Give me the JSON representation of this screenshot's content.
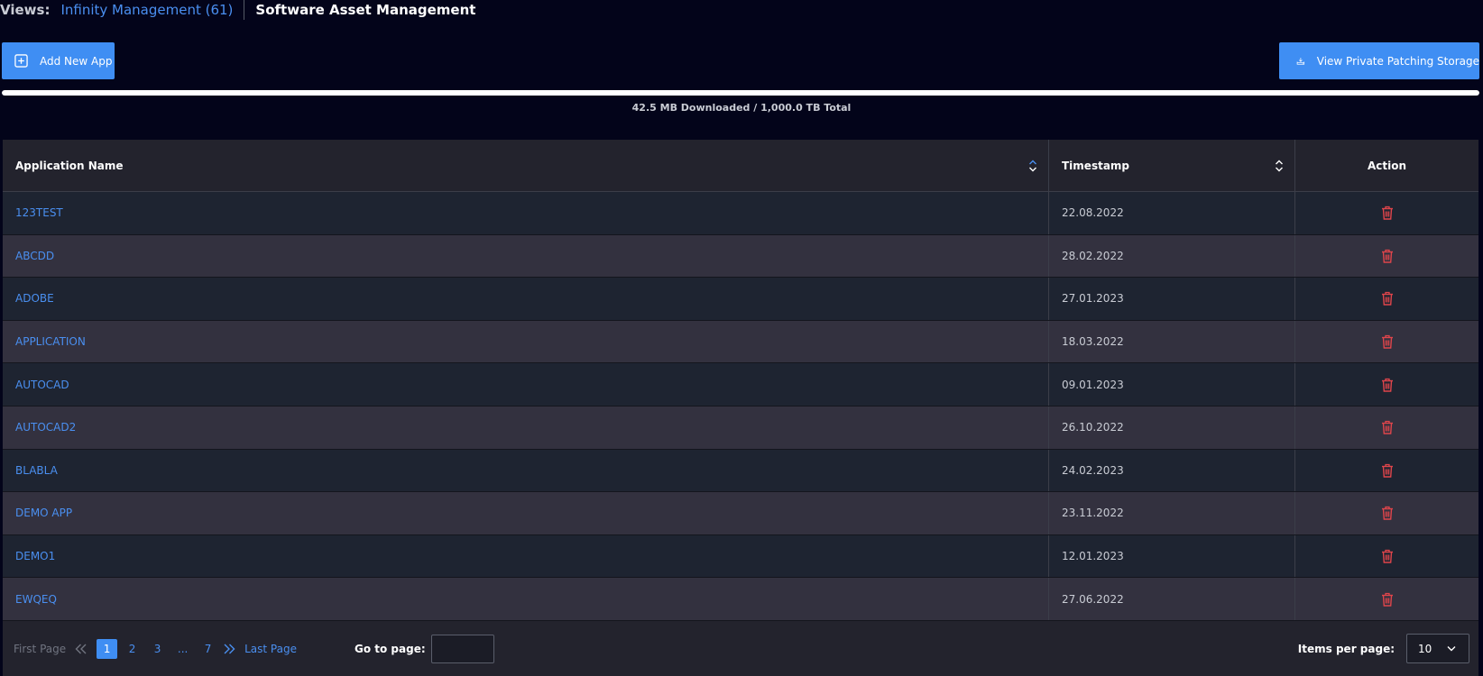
{
  "views": {
    "label": "Views:",
    "link": "Infinity Management (61)",
    "current": "Software Asset Management"
  },
  "toolbar": {
    "add_label": "Add New App",
    "storage_label": "View Private Patching Storage"
  },
  "storage": {
    "text": "42.5 MB Downloaded / 1,000.0 TB Total",
    "used_fraction": 1.0
  },
  "table": {
    "columns": [
      "Application Name",
      "Timestamp",
      "Action"
    ],
    "rows": [
      {
        "name": "123TEST",
        "timestamp": "22.08.2022"
      },
      {
        "name": "ABCDD",
        "timestamp": "28.02.2022"
      },
      {
        "name": "ADOBE",
        "timestamp": "27.01.2023"
      },
      {
        "name": "APPLICATION",
        "timestamp": "18.03.2022"
      },
      {
        "name": "AUTOCAD",
        "timestamp": "09.01.2023"
      },
      {
        "name": "AUTOCAD2",
        "timestamp": "26.10.2022"
      },
      {
        "name": "BLABLA",
        "timestamp": "24.02.2023"
      },
      {
        "name": "DEMO APP",
        "timestamp": "23.11.2022"
      },
      {
        "name": "DEMO1",
        "timestamp": "12.01.2023"
      },
      {
        "name": "EWQEQ",
        "timestamp": "27.06.2022"
      }
    ]
  },
  "pagination": {
    "first": "First Page",
    "last": "Last Page",
    "pages": [
      "1",
      "2",
      "3",
      "...",
      "7"
    ],
    "current_page": "1",
    "goto_label": "Go to page:",
    "goto_value": "",
    "items_per_page_label": "Items per page:",
    "items_per_page": "10"
  },
  "colors": {
    "accent": "#3f8ef3",
    "link": "#4a8ff0",
    "danger": "#e0454b",
    "background": "#03041a"
  },
  "icons": {
    "add": "plus-square-icon",
    "storage": "download-storage-icon",
    "sort": "sort-icon",
    "delete": "trash-icon",
    "prev": "double-chevron-left-icon",
    "next": "double-chevron-right-icon",
    "dropdown": "chevron-down-icon"
  }
}
